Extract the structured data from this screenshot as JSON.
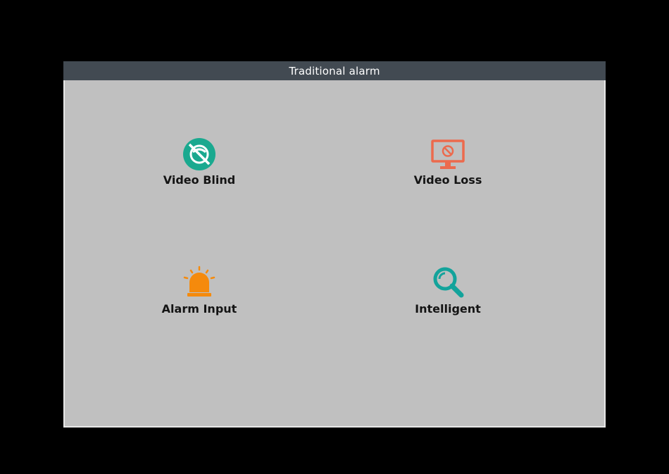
{
  "dialog": {
    "title": "Traditional alarm"
  },
  "tiles": [
    {
      "label": "Video Blind",
      "icon": "video-blind-icon",
      "color": "#1aa98f"
    },
    {
      "label": "Video Loss",
      "icon": "video-loss-icon",
      "color": "#ec6a4d"
    },
    {
      "label": "Alarm Input",
      "icon": "alarm-siren-icon",
      "color": "#f58a0c"
    },
    {
      "label": "Intelligent",
      "icon": "magnifier-icon",
      "color": "#13a39b"
    }
  ]
}
